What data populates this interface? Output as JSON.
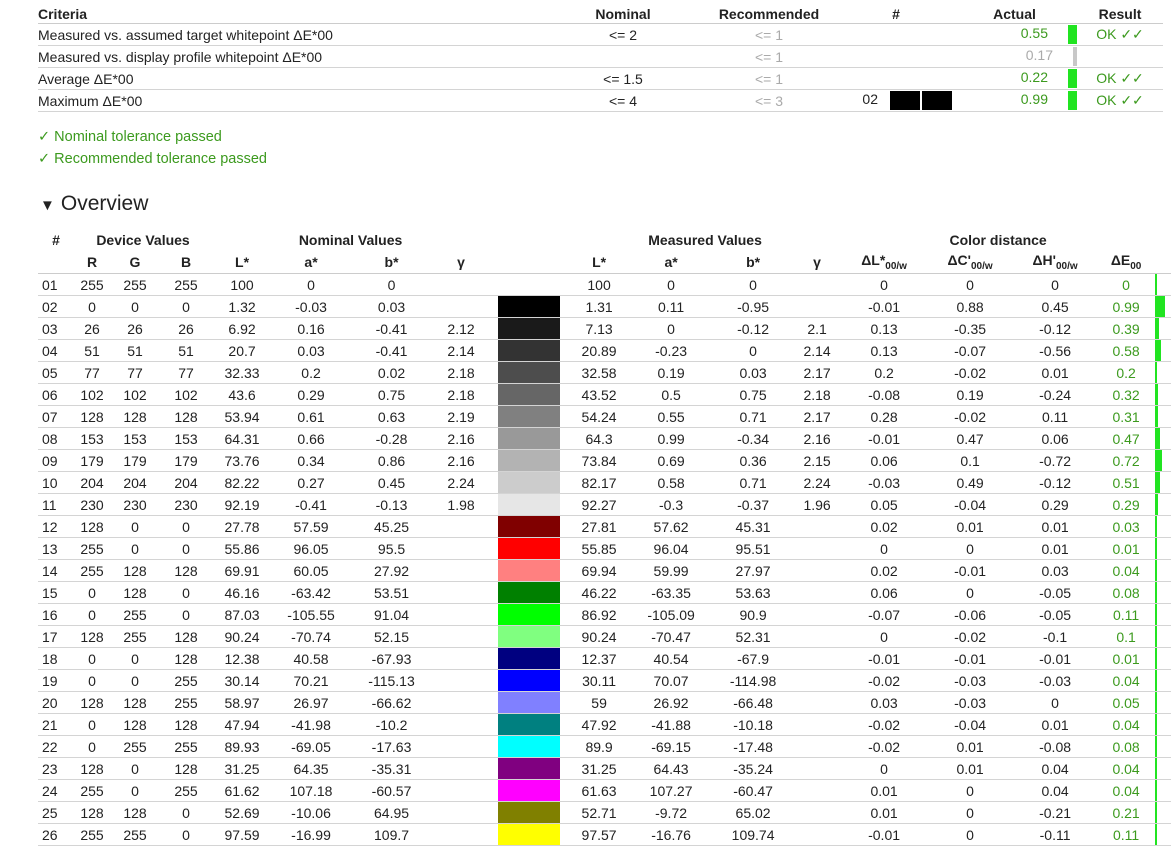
{
  "summary": {
    "headers": {
      "criteria": "Criteria",
      "nominal": "Nominal",
      "recommended": "Recommended",
      "num": "#",
      "actual": "Actual",
      "result": "Result"
    },
    "rows": [
      {
        "criteria": "Measured vs. assumed target whitepoint ΔE*00",
        "nominal": "<= 2",
        "recommended": "<= 1",
        "num": "",
        "actual": "0.55",
        "result": "OK ✓✓",
        "bar": "green"
      },
      {
        "criteria": "Measured vs. display profile whitepoint ΔE*00",
        "nominal": "",
        "recommended": "<= 1",
        "num": "",
        "actual": "0.17",
        "result": "",
        "bar": "gray"
      },
      {
        "criteria": "Average ΔE*00",
        "nominal": "<= 1.5",
        "recommended": "<= 1",
        "num": "",
        "actual": "0.22",
        "result": "OK ✓✓",
        "bar": "green"
      },
      {
        "criteria": "Maximum ΔE*00",
        "nominal": "<= 4",
        "recommended": "<= 3",
        "num": "02",
        "actual": "0.99",
        "result": "OK ✓✓",
        "bar": "green",
        "swatch": true
      }
    ]
  },
  "status": {
    "nominal": "✓ Nominal tolerance passed",
    "recommended": "✓ Recommended tolerance passed"
  },
  "overview": {
    "title": "Overview",
    "group_headers": {
      "num": "#",
      "device": "Device Values",
      "nominal": "Nominal Values",
      "measured": "Measured Values",
      "distance": "Color distance"
    },
    "col_headers": [
      "R",
      "G",
      "B",
      "L*",
      "a*",
      "b*",
      "γ",
      "L*",
      "a*",
      "b*",
      "γ",
      "ΔL*",
      "ΔC'",
      "ΔH'",
      "ΔE"
    ],
    "rows": [
      [
        "01",
        "255",
        "255",
        "255",
        "100",
        "0",
        "0",
        "",
        "#ffffff",
        "100",
        "0",
        "0",
        "",
        "0",
        "0",
        "0",
        "0"
      ],
      [
        "02",
        "0",
        "0",
        "0",
        "1.32",
        "-0.03",
        "0.03",
        "",
        "#000000",
        "1.31",
        "0.11",
        "-0.95",
        "",
        "-0.01",
        "0.88",
        "0.45",
        "0.99"
      ],
      [
        "03",
        "26",
        "26",
        "26",
        "6.92",
        "0.16",
        "-0.41",
        "2.12",
        "#1a1a1a",
        "7.13",
        "0",
        "-0.12",
        "2.1",
        "0.13",
        "-0.35",
        "-0.12",
        "0.39"
      ],
      [
        "04",
        "51",
        "51",
        "51",
        "20.7",
        "0.03",
        "-0.41",
        "2.14",
        "#333333",
        "20.89",
        "-0.23",
        "0",
        "2.14",
        "0.13",
        "-0.07",
        "-0.56",
        "0.58"
      ],
      [
        "05",
        "77",
        "77",
        "77",
        "32.33",
        "0.2",
        "0.02",
        "2.18",
        "#4d4d4d",
        "32.58",
        "0.19",
        "0.03",
        "2.17",
        "0.2",
        "-0.02",
        "0.01",
        "0.2"
      ],
      [
        "06",
        "102",
        "102",
        "102",
        "43.6",
        "0.29",
        "0.75",
        "2.18",
        "#666666",
        "43.52",
        "0.5",
        "0.75",
        "2.18",
        "-0.08",
        "0.19",
        "-0.24",
        "0.32"
      ],
      [
        "07",
        "128",
        "128",
        "128",
        "53.94",
        "0.61",
        "0.63",
        "2.19",
        "#808080",
        "54.24",
        "0.55",
        "0.71",
        "2.17",
        "0.28",
        "-0.02",
        "0.11",
        "0.31"
      ],
      [
        "08",
        "153",
        "153",
        "153",
        "64.31",
        "0.66",
        "-0.28",
        "2.16",
        "#999999",
        "64.3",
        "0.99",
        "-0.34",
        "2.16",
        "-0.01",
        "0.47",
        "0.06",
        "0.47"
      ],
      [
        "09",
        "179",
        "179",
        "179",
        "73.76",
        "0.34",
        "0.86",
        "2.16",
        "#b3b3b3",
        "73.84",
        "0.69",
        "0.36",
        "2.15",
        "0.06",
        "0.1",
        "-0.72",
        "0.72"
      ],
      [
        "10",
        "204",
        "204",
        "204",
        "82.22",
        "0.27",
        "0.45",
        "2.24",
        "#cccccc",
        "82.17",
        "0.58",
        "0.71",
        "2.24",
        "-0.03",
        "0.49",
        "-0.12",
        "0.51"
      ],
      [
        "11",
        "230",
        "230",
        "230",
        "92.19",
        "-0.41",
        "-0.13",
        "1.98",
        "#e6e6e6",
        "92.27",
        "-0.3",
        "-0.37",
        "1.96",
        "0.05",
        "-0.04",
        "0.29",
        "0.29"
      ],
      [
        "12",
        "128",
        "0",
        "0",
        "27.78",
        "57.59",
        "45.25",
        "",
        "#800000",
        "27.81",
        "57.62",
        "45.31",
        "",
        "0.02",
        "0.01",
        "0.01",
        "0.03"
      ],
      [
        "13",
        "255",
        "0",
        "0",
        "55.86",
        "96.05",
        "95.5",
        "",
        "#ff0000",
        "55.85",
        "96.04",
        "95.51",
        "",
        "0",
        "0",
        "0.01",
        "0.01"
      ],
      [
        "14",
        "255",
        "128",
        "128",
        "69.91",
        "60.05",
        "27.92",
        "",
        "#ff8080",
        "69.94",
        "59.99",
        "27.97",
        "",
        "0.02",
        "-0.01",
        "0.03",
        "0.04"
      ],
      [
        "15",
        "0",
        "128",
        "0",
        "46.16",
        "-63.42",
        "53.51",
        "",
        "#008000",
        "46.22",
        "-63.35",
        "53.63",
        "",
        "0.06",
        "0",
        "-0.05",
        "0.08"
      ],
      [
        "16",
        "0",
        "255",
        "0",
        "87.03",
        "-105.55",
        "91.04",
        "",
        "#00ff00",
        "86.92",
        "-105.09",
        "90.9",
        "",
        "-0.07",
        "-0.06",
        "-0.05",
        "0.11"
      ],
      [
        "17",
        "128",
        "255",
        "128",
        "90.24",
        "-70.74",
        "52.15",
        "",
        "#80ff80",
        "90.24",
        "-70.47",
        "52.31",
        "",
        "0",
        "-0.02",
        "-0.1",
        "0.1"
      ],
      [
        "18",
        "0",
        "0",
        "128",
        "12.38",
        "40.58",
        "-67.93",
        "",
        "#000080",
        "12.37",
        "40.54",
        "-67.9",
        "",
        "-0.01",
        "-0.01",
        "-0.01",
        "0.01"
      ],
      [
        "19",
        "0",
        "0",
        "255",
        "30.14",
        "70.21",
        "-115.13",
        "",
        "#0000ff",
        "30.11",
        "70.07",
        "-114.98",
        "",
        "-0.02",
        "-0.03",
        "-0.03",
        "0.04"
      ],
      [
        "20",
        "128",
        "128",
        "255",
        "58.97",
        "26.97",
        "-66.62",
        "",
        "#8080ff",
        "59",
        "26.92",
        "-66.48",
        "",
        "0.03",
        "-0.03",
        "0",
        "0.05"
      ],
      [
        "21",
        "0",
        "128",
        "128",
        "47.94",
        "-41.98",
        "-10.2",
        "",
        "#008080",
        "47.92",
        "-41.88",
        "-10.18",
        "",
        "-0.02",
        "-0.04",
        "0.01",
        "0.04"
      ],
      [
        "22",
        "0",
        "255",
        "255",
        "89.93",
        "-69.05",
        "-17.63",
        "",
        "#00ffff",
        "89.9",
        "-69.15",
        "-17.48",
        "",
        "-0.02",
        "0.01",
        "-0.08",
        "0.08"
      ],
      [
        "23",
        "128",
        "0",
        "128",
        "31.25",
        "64.35",
        "-35.31",
        "",
        "#800080",
        "31.25",
        "64.43",
        "-35.24",
        "",
        "0",
        "0.01",
        "0.04",
        "0.04"
      ],
      [
        "24",
        "255",
        "0",
        "255",
        "61.62",
        "107.18",
        "-60.57",
        "",
        "#ff00ff",
        "61.63",
        "107.27",
        "-60.47",
        "",
        "0.01",
        "0",
        "0.04",
        "0.04"
      ],
      [
        "25",
        "128",
        "128",
        "0",
        "52.69",
        "-10.06",
        "64.95",
        "",
        "#808000",
        "52.71",
        "-9.72",
        "65.02",
        "",
        "0.01",
        "0",
        "-0.21",
        "0.21"
      ],
      [
        "26",
        "255",
        "255",
        "0",
        "97.59",
        "-16.99",
        "109.7",
        "",
        "#ffff00",
        "97.57",
        "-16.76",
        "109.74",
        "",
        "-0.01",
        "0",
        "-0.11",
        "0.11"
      ]
    ]
  }
}
